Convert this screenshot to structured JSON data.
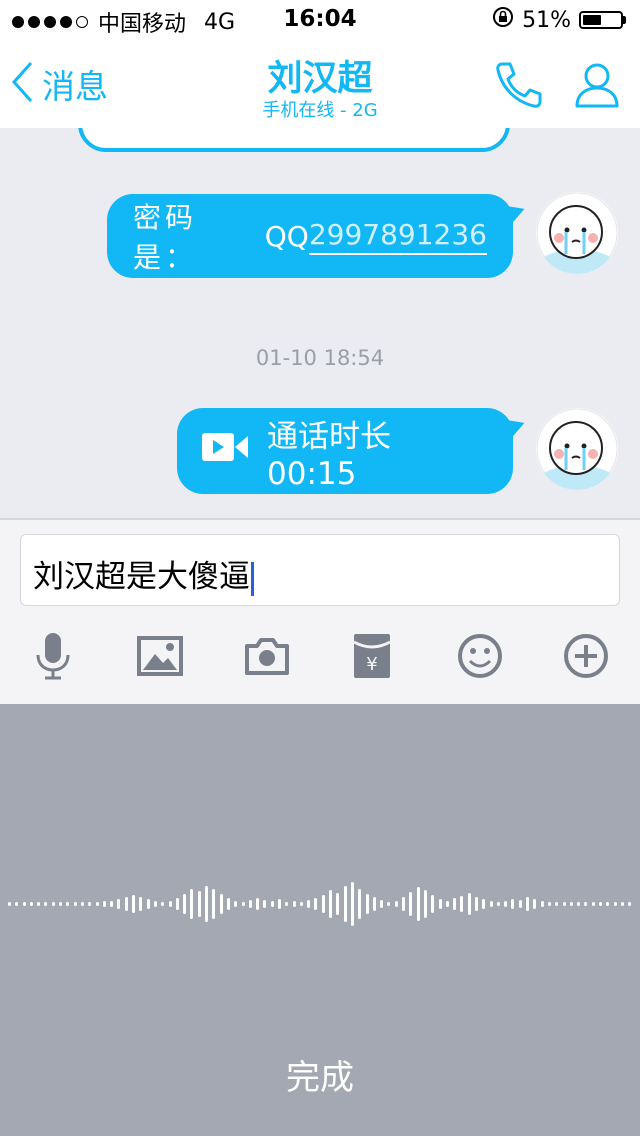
{
  "status_bar": {
    "carrier": "中国移动",
    "network": "4G",
    "time": "16:04",
    "battery": "51%",
    "battery_level": 0.51
  },
  "nav": {
    "back_label": "消息",
    "title": "刘汉超",
    "subtitle": "手机在线 - 2G"
  },
  "messages": {
    "password_label": "密码是：",
    "qq_prefix": "QQ",
    "qq_number": "2997891236",
    "timestamp": "01-10 18:54",
    "call_text": "通话时长 00:15"
  },
  "input": {
    "value": "刘汉超是大傻逼"
  },
  "voice": {
    "done_label": "完成"
  },
  "colors": {
    "accent": "#12b7f5",
    "chat_bg": "#ebecf1",
    "voice_panel_bg": "#a3a8b2"
  },
  "icons": [
    "back-chevron-icon",
    "phone-icon",
    "profile-icon",
    "video-call-icon",
    "microphone-icon",
    "image-icon",
    "camera-icon",
    "red-packet-icon",
    "emoji-icon",
    "plus-icon"
  ]
}
